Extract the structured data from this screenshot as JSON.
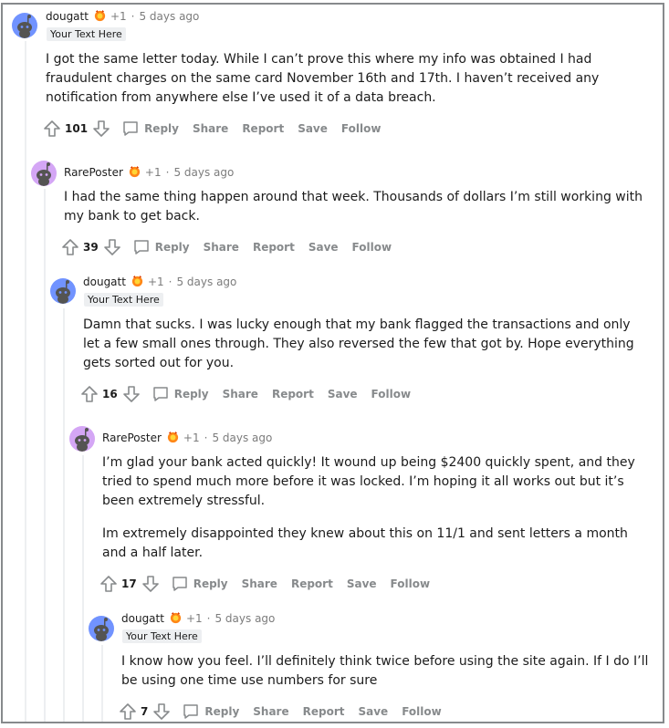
{
  "comments": [
    {
      "username": "dougatt",
      "karma": "+1",
      "separator": "·",
      "time": "5 days ago",
      "flair": "Your Text Here",
      "paragraphs": [
        "I got the same letter today. While I can’t prove this where my info was obtained I had fraudulent charges on the same card November 16th and 17th. I haven’t received any notification from anywhere else I’ve used it of a data breach."
      ],
      "score": "101",
      "actions": {
        "reply": "Reply",
        "share": "Share",
        "report": "Report",
        "save": "Save",
        "follow": "Follow"
      }
    },
    {
      "username": "RarePoster",
      "karma": "+1",
      "separator": "·",
      "time": "5 days ago",
      "flair": "",
      "paragraphs": [
        "I had the same thing happen around that week. Thousands of dollars I’m still working with my bank to get back."
      ],
      "score": "39",
      "actions": {
        "reply": "Reply",
        "share": "Share",
        "report": "Report",
        "save": "Save",
        "follow": "Follow"
      }
    },
    {
      "username": "dougatt",
      "karma": "+1",
      "separator": "·",
      "time": "5 days ago",
      "flair": "Your Text Here",
      "paragraphs": [
        "Damn that sucks. I was lucky enough that my bank flagged the transactions and only let a few small ones through. They also reversed the few that got by. Hope everything gets sorted out for you."
      ],
      "score": "16",
      "actions": {
        "reply": "Reply",
        "share": "Share",
        "report": "Report",
        "save": "Save",
        "follow": "Follow"
      }
    },
    {
      "username": "RarePoster",
      "karma": "+1",
      "separator": "·",
      "time": "5 days ago",
      "flair": "",
      "paragraphs": [
        "I’m glad your bank acted quickly! It wound up being $2400 quickly spent, and they tried to spend much more before it was locked. I’m hoping it all works out but it’s been extremely stressful.",
        "Im extremely disappointed they knew about this on 11/1 and sent letters a month and a half later."
      ],
      "score": "17",
      "actions": {
        "reply": "Reply",
        "share": "Share",
        "report": "Report",
        "save": "Save",
        "follow": "Follow"
      }
    },
    {
      "username": "dougatt",
      "karma": "+1",
      "separator": "·",
      "time": "5 days ago",
      "flair": "Your Text Here",
      "paragraphs": [
        "I know how you feel. I’ll definitely think twice before using the site again. If I do I’ll be using one time use numbers for sure"
      ],
      "score": "7",
      "actions": {
        "reply": "Reply",
        "share": "Share",
        "report": "Report",
        "save": "Save",
        "follow": "Follow"
      }
    }
  ],
  "colors": {
    "avatar_dougatt_bg": "#7193ff",
    "avatar_rareposter_bg": "#d4a6f5",
    "snoo_dark": "#545452",
    "meta_gray": "#7c7c7c",
    "action_gray": "#878a8c",
    "thread_line": "#edeff1"
  }
}
